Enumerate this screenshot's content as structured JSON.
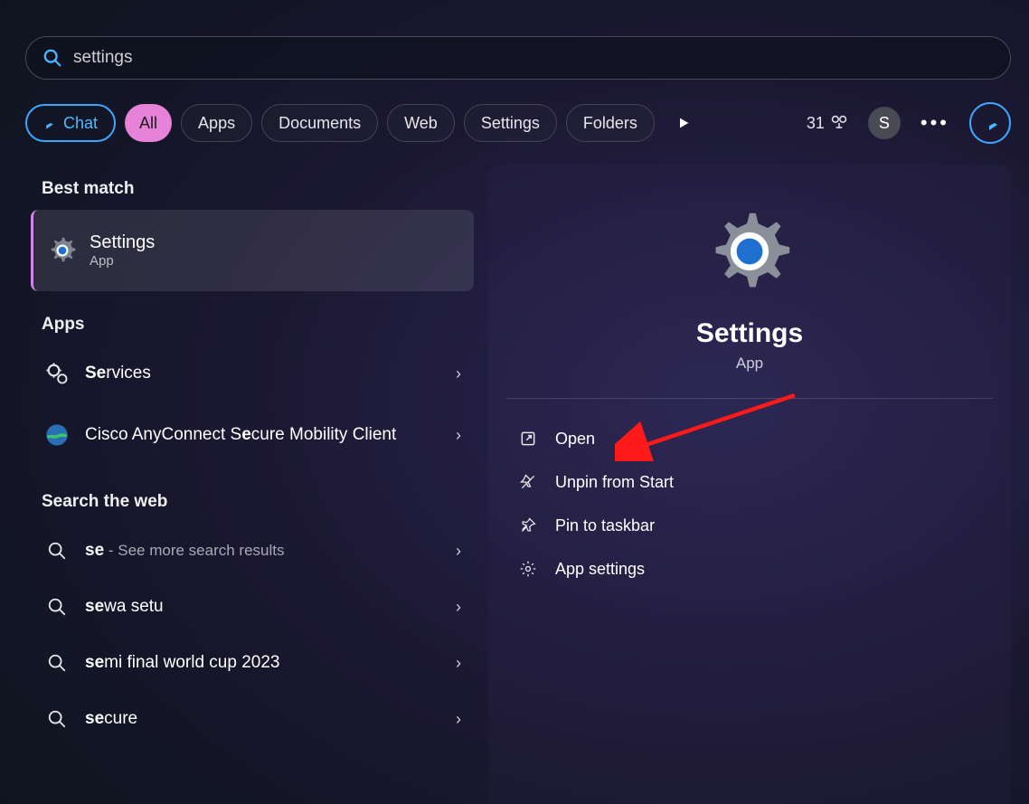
{
  "search": {
    "value": "settings"
  },
  "filters": {
    "chat": "Chat",
    "all": "All",
    "apps": "Apps",
    "documents": "Documents",
    "web": "Web",
    "settings": "Settings",
    "folders": "Folders"
  },
  "topbar": {
    "points": "31",
    "avatar_letter": "S"
  },
  "left": {
    "best_match_heading": "Best match",
    "best_match": {
      "title": "Settings",
      "subtitle": "App"
    },
    "apps_heading": "Apps",
    "apps": [
      {
        "prefix": "Se",
        "rest": "rvices"
      },
      {
        "full": "Cisco AnyConnect Secure Mobility Client",
        "bold_at": 20
      }
    ],
    "web_heading": "Search the web",
    "web": [
      {
        "prefix": "se",
        "hint": " - See more search results"
      },
      {
        "prefix": "se",
        "rest": "wa setu"
      },
      {
        "prefix": "se",
        "rest": "mi final world cup 2023"
      },
      {
        "prefix": "se",
        "rest": "cure"
      }
    ]
  },
  "detail": {
    "title": "Settings",
    "subtitle": "App",
    "actions": {
      "open": "Open",
      "unpin": "Unpin from Start",
      "pin": "Pin to taskbar",
      "app_settings": "App settings"
    }
  }
}
